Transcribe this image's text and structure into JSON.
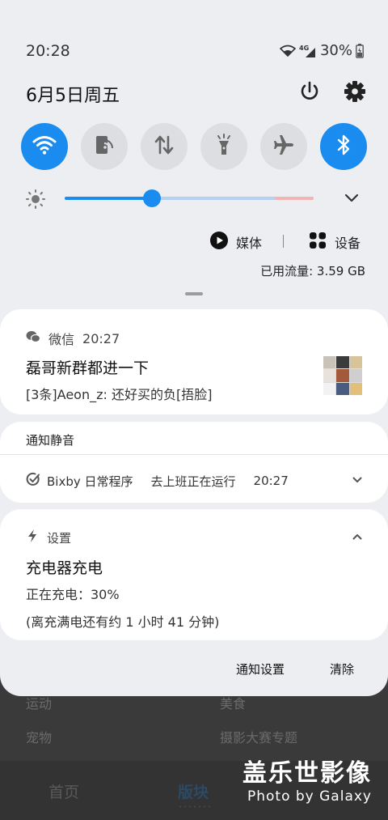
{
  "status_bar": {
    "time": "20:28",
    "network": "4G",
    "battery": "30%"
  },
  "header": {
    "date": "6月5日周五"
  },
  "quick_toggles": [
    {
      "name": "wifi",
      "icon": "wifi-icon",
      "on": true
    },
    {
      "name": "mobile-hotspot",
      "icon": "hotspot-icon",
      "on": false
    },
    {
      "name": "mobile-data",
      "icon": "data-arrows-icon",
      "on": false
    },
    {
      "name": "flashlight",
      "icon": "flashlight-icon",
      "on": false
    },
    {
      "name": "airplane-mode",
      "icon": "airplane-icon",
      "on": false
    },
    {
      "name": "bluetooth",
      "icon": "bluetooth-icon",
      "on": true
    }
  ],
  "brightness": {
    "level": 0.35
  },
  "media": {
    "media_label": "媒体",
    "devices_label": "设备"
  },
  "data_usage": "已用流量: 3.59 GB",
  "notifications": {
    "wechat": {
      "app": "微信",
      "time": "20:27",
      "title": "磊哥新群都进一下",
      "body": "[3条]Aeon_z: 还好买的负[捂脸]"
    },
    "silent": {
      "section_title": "通知静音",
      "bixby_app": "Bixby 日常程序",
      "bixby_text": "去上班正在运行",
      "bixby_time": "20:27"
    },
    "charging": {
      "app": "设置",
      "title": "充电器充电",
      "line1": "正在充电：30%",
      "line2": "(离充满电还有约 1 小时 41 分钟)"
    }
  },
  "actions": {
    "notification_settings": "通知设置",
    "clear": "清除"
  },
  "background_app": {
    "row1": [
      "运动",
      "美食"
    ],
    "row2": [
      "宠物",
      "摄影大赛专题"
    ],
    "tabs": [
      "首页",
      "版块"
    ]
  },
  "watermark": {
    "title": "盖乐世影像",
    "subtitle": "Photo by Galaxy"
  },
  "colors": {
    "accent": "#1a8cf0",
    "shade_bg": "#eceef2",
    "card_bg": "#ffffff"
  }
}
